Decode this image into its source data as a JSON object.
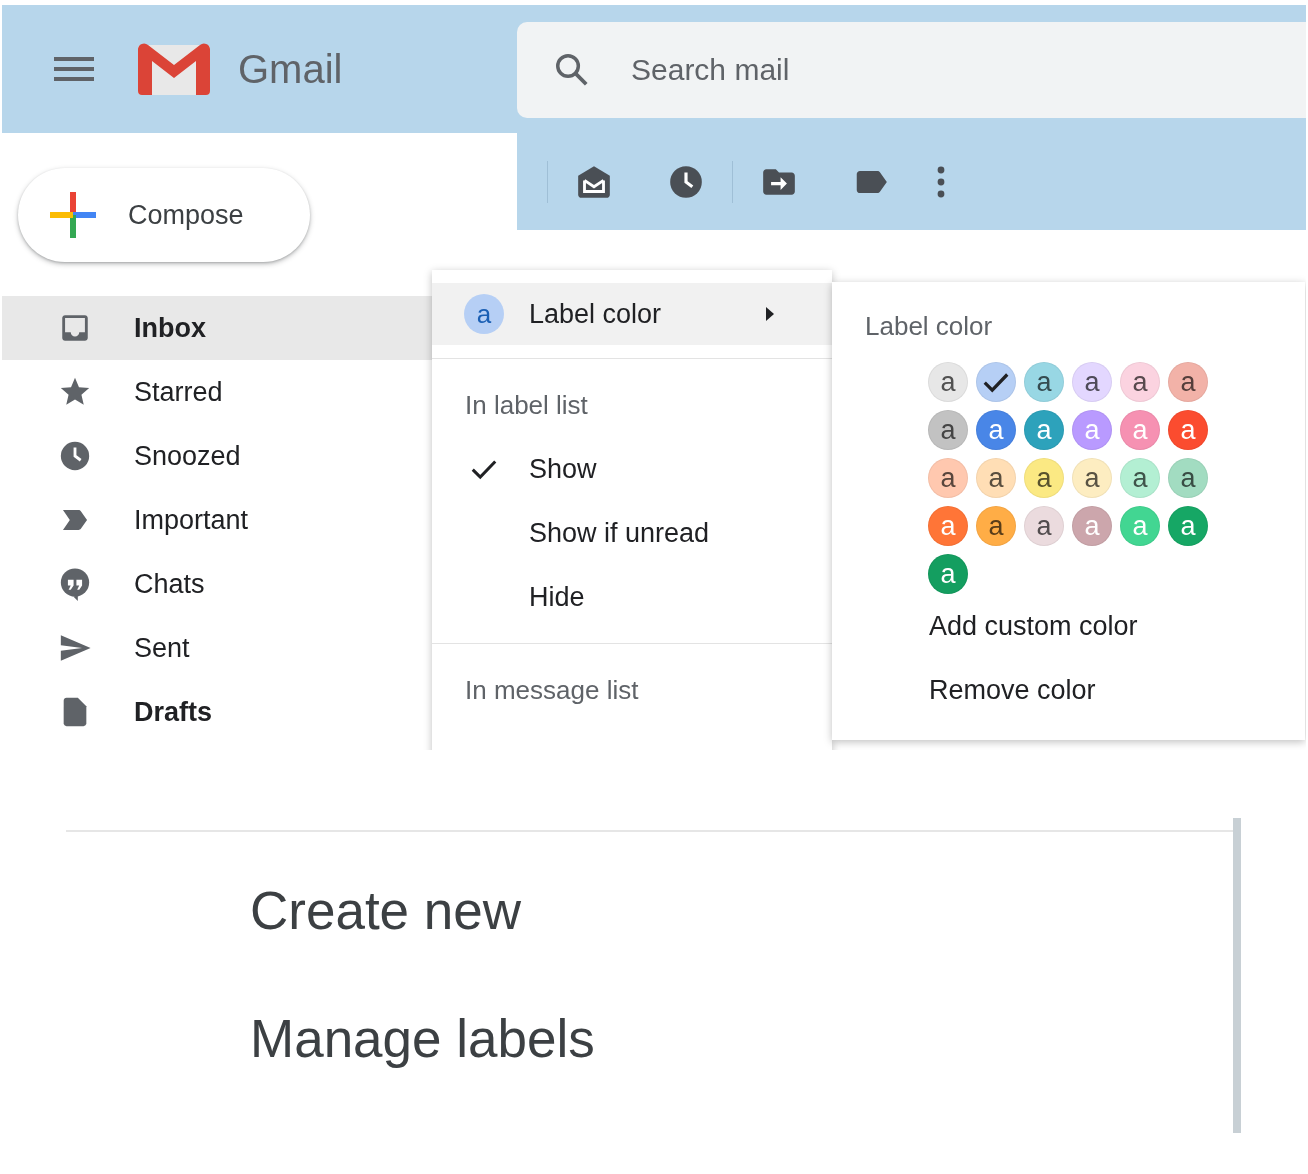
{
  "header": {
    "app_name": "Gmail",
    "search": {
      "placeholder": "Search mail"
    }
  },
  "compose": {
    "label": "Compose"
  },
  "nav": [
    {
      "label": "Inbox",
      "kind": "inbox",
      "selected": true,
      "unread": true
    },
    {
      "label": "Starred",
      "kind": "star",
      "selected": false,
      "unread": false
    },
    {
      "label": "Snoozed",
      "kind": "clock",
      "selected": false,
      "unread": false
    },
    {
      "label": "Important",
      "kind": "important",
      "selected": false,
      "unread": false
    },
    {
      "label": "Chats",
      "kind": "chat",
      "selected": false,
      "unread": false
    },
    {
      "label": "Sent",
      "kind": "send",
      "selected": false,
      "unread": false
    },
    {
      "label": "Drafts",
      "kind": "file",
      "selected": false,
      "unread": true
    }
  ],
  "label_menu": {
    "submenu": {
      "label": "Label color",
      "swatch": {
        "text": "a",
        "color": "#b6cff5"
      },
      "selected": true
    },
    "sections": [
      {
        "heading": "In label list",
        "options": [
          {
            "label": "Show",
            "checked": true
          },
          {
            "label": "Show if unread",
            "checked": false
          },
          {
            "label": "Hide",
            "checked": false
          }
        ]
      },
      {
        "heading": "In message list"
      }
    ]
  },
  "color_menu": {
    "title": "Label color",
    "swatches": [
      {
        "text": "a",
        "color": "#e7e7e7",
        "selected": false
      },
      {
        "color": "#b6cff5",
        "selected": true
      },
      {
        "text": "a",
        "color": "#98d7e4",
        "selected": false
      },
      {
        "text": "a",
        "color": "#e3d7ff",
        "selected": false
      },
      {
        "text": "a",
        "color": "#fbd3e0",
        "selected": false
      },
      {
        "text": "a",
        "color": "#f2b2a8",
        "selected": false
      },
      {
        "text": "a",
        "color": "#c2c2c2",
        "selected": false
      },
      {
        "text": "a",
        "color": "#4986e7",
        "selected": false
      },
      {
        "text": "a",
        "color": "#2da2bb",
        "selected": false
      },
      {
        "text": "a",
        "color": "#b99aff",
        "selected": false
      },
      {
        "text": "a",
        "color": "#f691b2",
        "selected": false
      },
      {
        "text": "a",
        "color": "#fb4c2f",
        "selected": false
      },
      {
        "text": "a",
        "color": "#ffc8af",
        "selected": false
      },
      {
        "text": "a",
        "color": "#ffdeb5",
        "selected": false
      },
      {
        "text": "a",
        "color": "#fbe983",
        "selected": false
      },
      {
        "text": "a",
        "color": "#fdedc1",
        "selected": false
      },
      {
        "text": "a",
        "color": "#b3efd3",
        "selected": false
      },
      {
        "text": "a",
        "color": "#a2dcc1",
        "selected": false
      },
      {
        "text": "a",
        "color": "#ff7537",
        "selected": false
      },
      {
        "text": "a",
        "color": "#ffad46",
        "selected": false
      },
      {
        "text": "a",
        "color": "#ebdbde",
        "selected": false
      },
      {
        "text": "a",
        "color": "#cca6ac",
        "selected": false
      },
      {
        "text": "a",
        "color": "#42d692",
        "selected": false
      },
      {
        "text": "a",
        "color": "#16a765",
        "selected": false
      },
      {
        "text": "a",
        "color": "#149e60",
        "selected": false
      }
    ],
    "actions": [
      "Add custom color",
      "Remove color"
    ]
  },
  "labels_menu": {
    "items": [
      "Create new",
      "Manage labels"
    ]
  }
}
